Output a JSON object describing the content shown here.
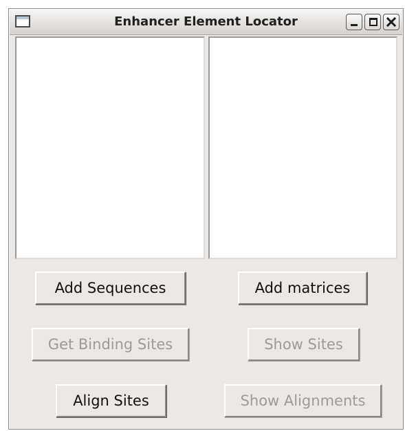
{
  "window": {
    "title": "Enhancer Element Locator",
    "controls": [
      "minimize-icon",
      "maximize-icon",
      "close-icon"
    ]
  },
  "panes": {
    "left": {
      "items": []
    },
    "right": {
      "items": []
    }
  },
  "buttons": {
    "add_sequences": {
      "label": "Add Sequences",
      "enabled": true
    },
    "add_matrices": {
      "label": "Add matrices",
      "enabled": true
    },
    "get_binding_sites": {
      "label": "Get Binding Sites",
      "enabled": false
    },
    "show_sites": {
      "label": "Show Sites",
      "enabled": false
    },
    "align_sites": {
      "label": "Align Sites",
      "enabled": true
    },
    "show_alignments": {
      "label": "Show Alignments",
      "enabled": false
    }
  },
  "colors": {
    "window_bg": "#ebe8e6",
    "disabled_text": "#9d9a98",
    "enabled_text": "#111111"
  }
}
